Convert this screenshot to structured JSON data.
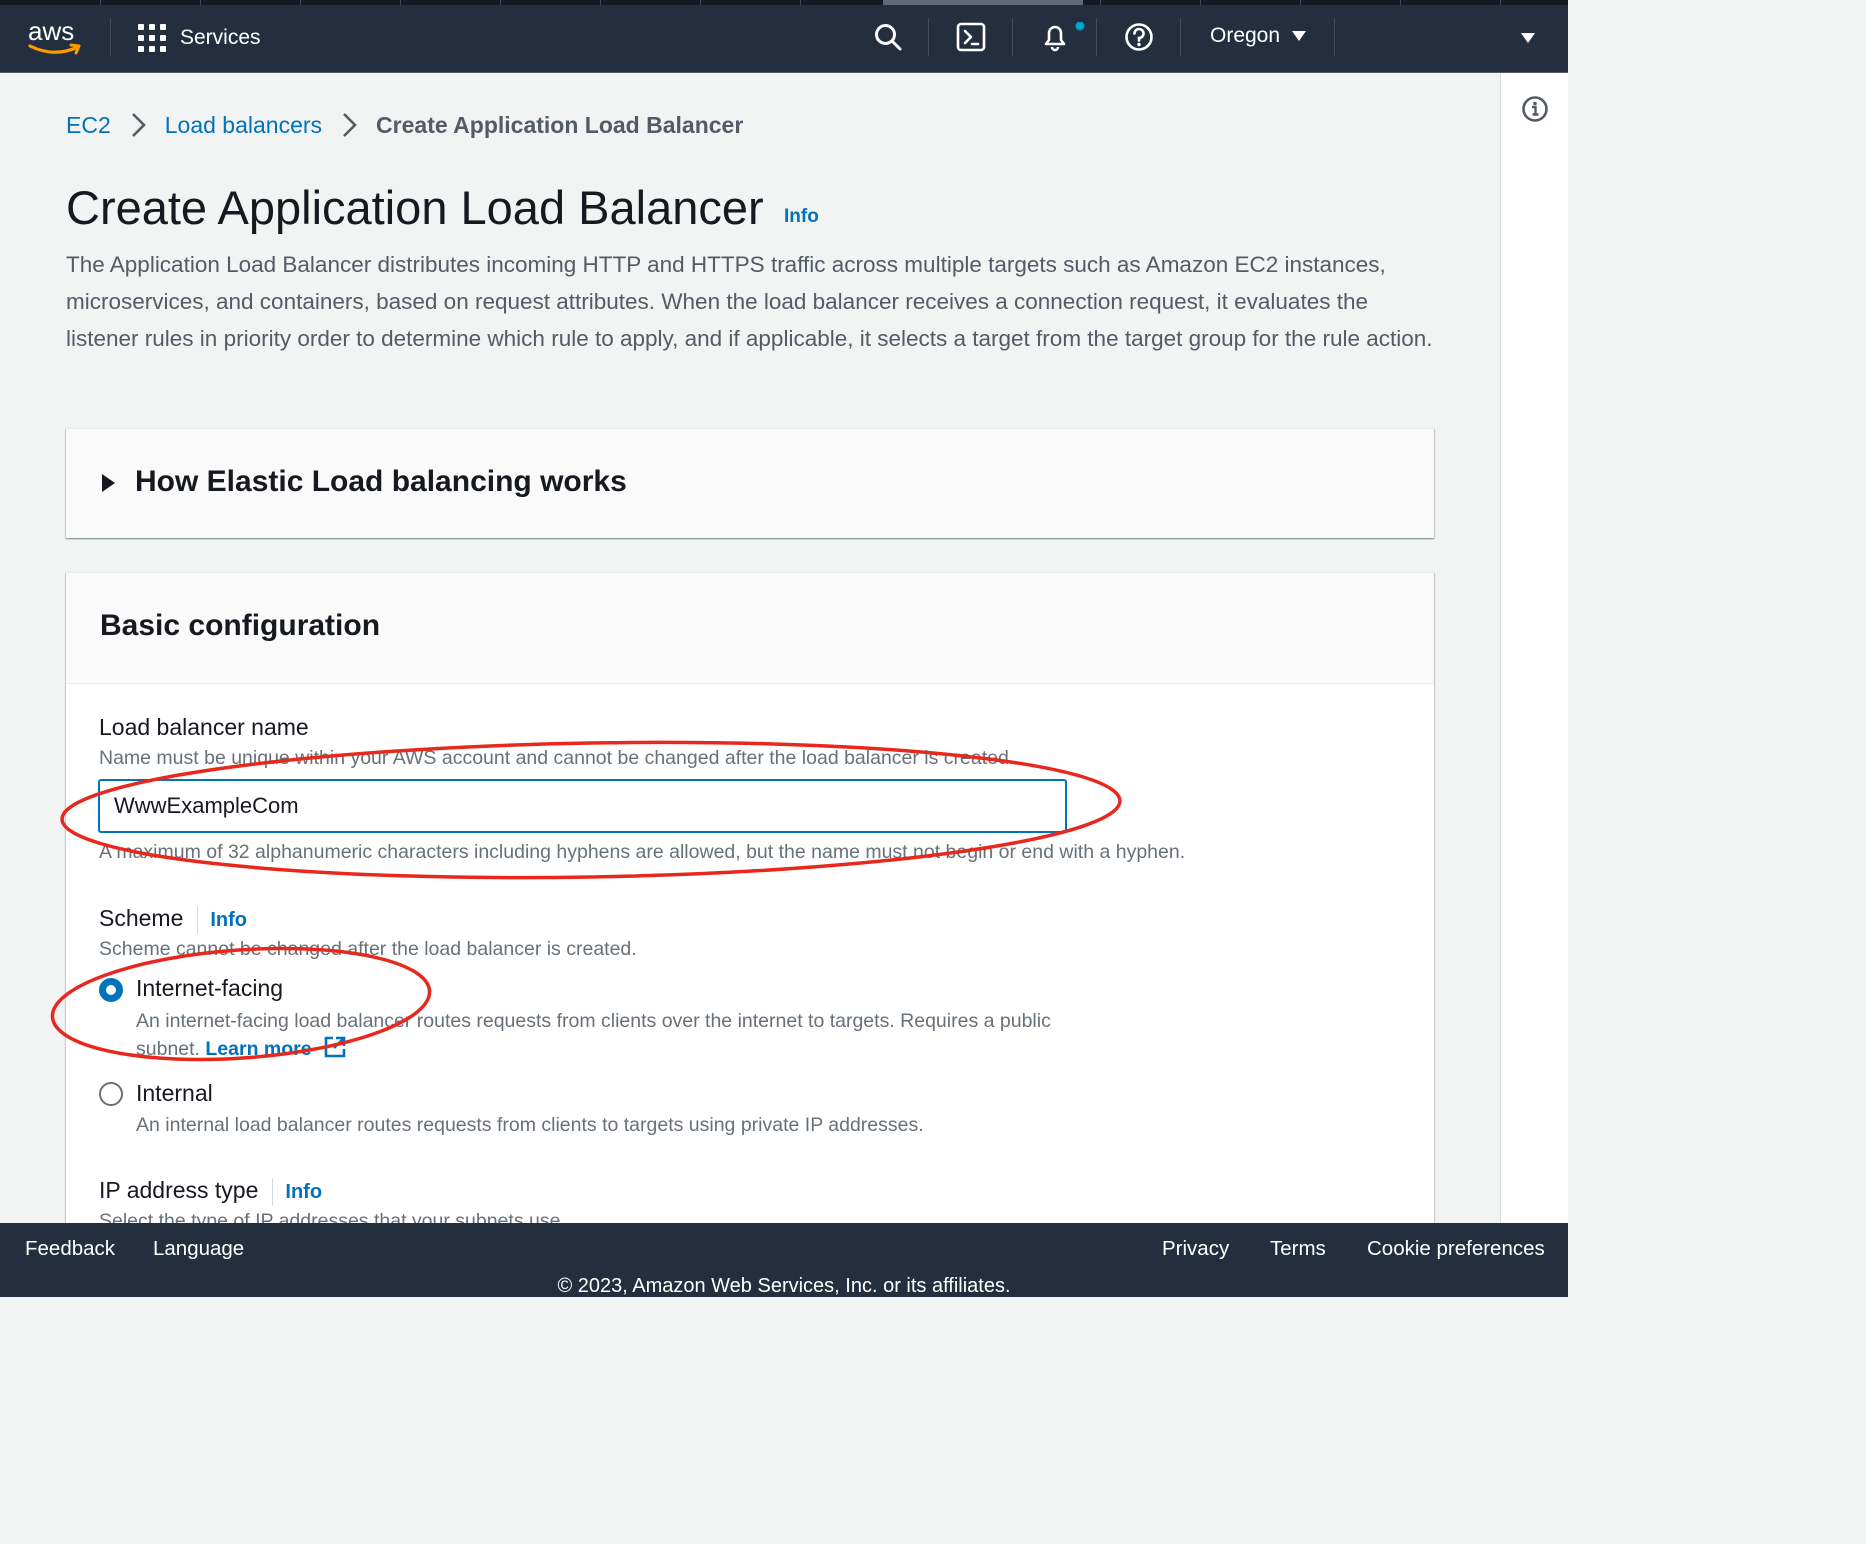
{
  "topnav": {
    "logo_text": "aws",
    "services_label": "Services",
    "region_label": "Oregon",
    "icons": [
      "search-icon",
      "cloudshell-icon",
      "notifications-icon",
      "help-icon"
    ],
    "notification_dot_color": "#00a1c9"
  },
  "breadcrumb": {
    "items": [
      "EC2",
      "Load balancers"
    ],
    "current": "Create Application Load Balancer"
  },
  "page": {
    "title": "Create Application Load Balancer",
    "info_label": "Info",
    "description": "The Application Load Balancer distributes incoming HTTP and HTTPS traffic across multiple targets such as Amazon EC2 instances, microservices, and containers, based on request attributes. When the load balancer receives a connection request, it evaluates the listener rules in priority order to determine which rule to apply, and if applicable, it selects a target from the target group for the rule action."
  },
  "how_it_works": {
    "title": "How Elastic Load balancing works"
  },
  "basic_config": {
    "title": "Basic configuration",
    "name": {
      "label": "Load balancer name",
      "description": "Name must be unique within your AWS account and cannot be changed after the load balancer is created.",
      "value": "WwwExampleCom",
      "constraint": "A maximum of 32 alphanumeric characters including hyphens are allowed, but the name must not begin or end with a hyphen."
    },
    "scheme": {
      "label": "Scheme",
      "info_label": "Info",
      "description": "Scheme cannot be changed after the load balancer is created.",
      "options": [
        {
          "label": "Internet-facing",
          "description": "An internet-facing load balancer routes requests from clients over the internet to targets. Requires a public subnet.",
          "link": "Learn more",
          "selected": true
        },
        {
          "label": "Internal",
          "description": "An internal load balancer routes requests from clients to targets using private IP addresses.",
          "selected": false
        }
      ]
    },
    "ip_type": {
      "label": "IP address type",
      "info_label": "Info",
      "description": "Select the type of IP addresses that your subnets use."
    }
  },
  "footer": {
    "feedback": "Feedback",
    "language": "Language",
    "privacy": "Privacy",
    "terms": "Terms",
    "cookies": "Cookie preferences",
    "copyright": "© 2023, Amazon Web Services, Inc. or its affiliates."
  },
  "colors": {
    "nav_bg": "#232f3e",
    "link": "#0073bb",
    "annotation": "#e8281c",
    "page_bg": "#f2f3f3"
  }
}
